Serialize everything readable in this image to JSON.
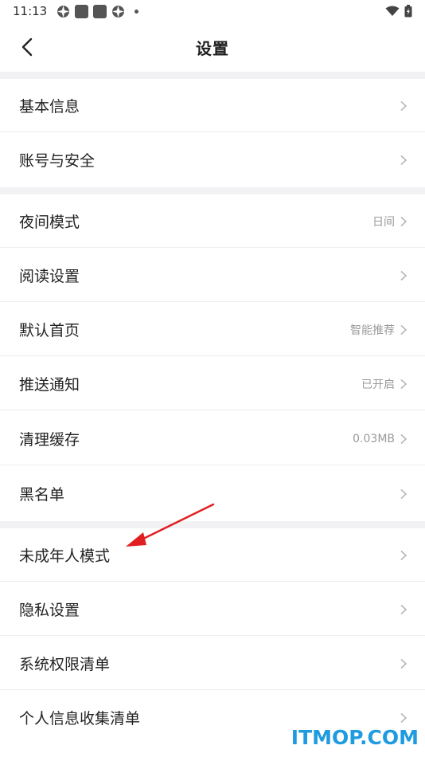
{
  "status_bar": {
    "time": "11:13"
  },
  "header": {
    "title": "设置"
  },
  "groups": [
    {
      "items": [
        {
          "label": "基本信息",
          "value": ""
        },
        {
          "label": "账号与安全",
          "value": ""
        }
      ]
    },
    {
      "items": [
        {
          "label": "夜间模式",
          "value": "日间"
        },
        {
          "label": "阅读设置",
          "value": ""
        },
        {
          "label": "默认首页",
          "value": "智能推荐"
        },
        {
          "label": "推送通知",
          "value": "已开启"
        },
        {
          "label": "清理缓存",
          "value": "0.03MB"
        },
        {
          "label": "黑名单",
          "value": ""
        }
      ]
    },
    {
      "items": [
        {
          "label": "未成年人模式",
          "value": ""
        },
        {
          "label": "隐私设置",
          "value": ""
        },
        {
          "label": "系统权限清单",
          "value": ""
        },
        {
          "label": "个人信息收集清单",
          "value": ""
        }
      ]
    }
  ],
  "watermark": "ITMOP.COM",
  "colors": {
    "annotation_arrow": "#e02020",
    "watermark": "#1f9be0"
  }
}
